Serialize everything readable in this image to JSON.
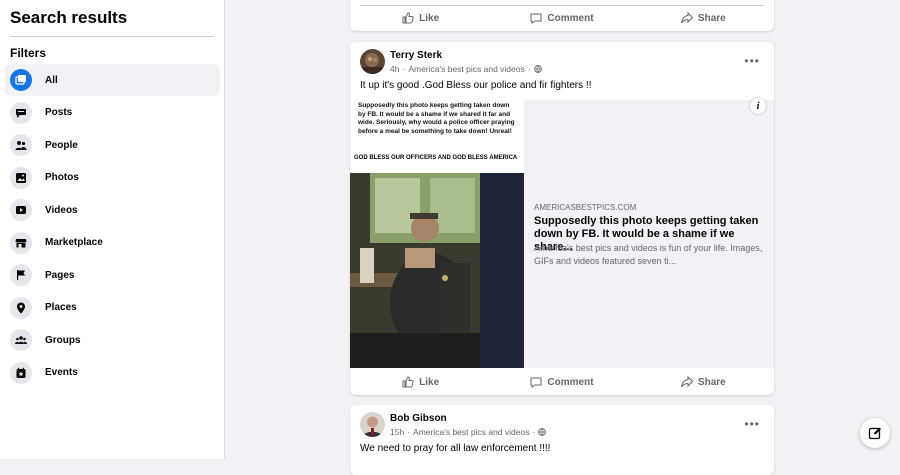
{
  "sidebar": {
    "title": "Search results",
    "filters_heading": "Filters",
    "items": [
      {
        "label": "All",
        "icon": "all-icon",
        "active": true
      },
      {
        "label": "Posts",
        "icon": "posts-icon"
      },
      {
        "label": "People",
        "icon": "people-icon"
      },
      {
        "label": "Photos",
        "icon": "photos-icon"
      },
      {
        "label": "Videos",
        "icon": "videos-icon"
      },
      {
        "label": "Marketplace",
        "icon": "marketplace-icon"
      },
      {
        "label": "Pages",
        "icon": "pages-icon"
      },
      {
        "label": "Places",
        "icon": "places-icon"
      },
      {
        "label": "Groups",
        "icon": "groups-icon"
      },
      {
        "label": "Events",
        "icon": "events-icon"
      }
    ]
  },
  "actions": {
    "like": "Like",
    "comment": "Comment",
    "share": "Share"
  },
  "posts": [
    {
      "author": "Terry Sterk",
      "time": "4h",
      "source": "America's best pics and videos",
      "text": "It up it's good .God Bless our police and fir fighters !!",
      "link": {
        "image_caption": "Supposedly this photo keeps getting taken down by FB.  It would be a shame if we shared it far and wide.  Seriously, why would a police officer praying before a meal be something to take down! Unreal!",
        "image_caption2": "GOD BLESS OUR OFFICERS AND GOD BLESS AMERICA",
        "domain": "AMERICASBESTPICS.COM",
        "title": "Supposedly this photo keeps getting taken down by FB. It would be a shame if we share...",
        "description": "America's best pics and videos is fun of your life. Images, GIFs and videos featured seven ti..."
      }
    },
    {
      "author": "Bob Gibson",
      "time": "15h",
      "source": "America's best pics and videos",
      "text": "We need to pray for all law enforcement !!!!"
    }
  ],
  "colors": {
    "accent": "#1b74e4",
    "background": "#f0f2f5",
    "secondary_text": "#65676b"
  }
}
